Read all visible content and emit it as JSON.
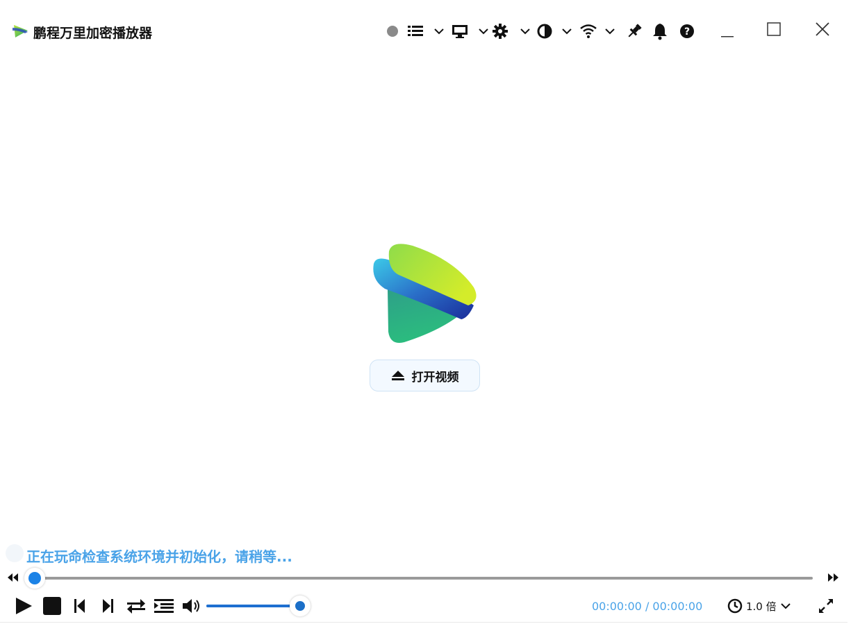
{
  "window": {
    "title": "鹏程万里加密播放器"
  },
  "toolbar": {
    "icons": [
      "record-dot-icon",
      "playlist-icon",
      "chevron-down-icon",
      "monitor-icon",
      "chevron-down-icon",
      "gear-icon",
      "chevron-down-icon",
      "contrast-icon",
      "chevron-down-icon",
      "wifi-icon",
      "chevron-down-icon",
      "pin-icon",
      "bell-icon",
      "help-icon"
    ],
    "window_controls": [
      "minimize-icon",
      "maximize-icon",
      "close-icon"
    ]
  },
  "main": {
    "open_button_label": "打开视频"
  },
  "status": {
    "message": "正在玩命检查系统环境并初始化，请稍等..."
  },
  "player": {
    "progress": 0.0,
    "volume": 1.0,
    "time_display": "00:00:00 / 00:00:00",
    "speed_label": "1.0 倍"
  },
  "colors": {
    "accent": "#1b82e6",
    "status_text": "#4aa3e8",
    "open_button_bg": "#f3f9ff"
  }
}
